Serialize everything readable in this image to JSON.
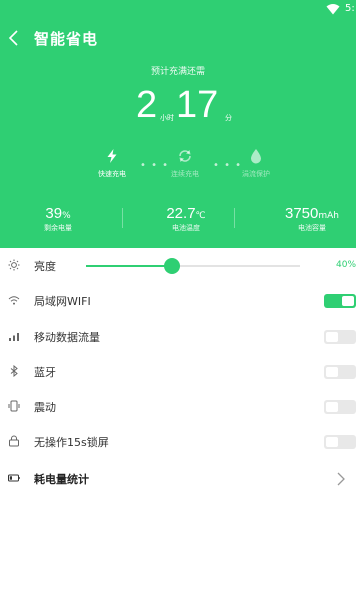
{
  "colors": {
    "accent": "#2fcf73",
    "header_bg": "#2fcf73",
    "text": "#333333"
  },
  "status_bar": {
    "time": "5:",
    "wifi_icon": "wifi-icon"
  },
  "header": {
    "back_icon": "back-arrow-icon",
    "title": "智能省电",
    "subtitle": "预计充满还需",
    "time": {
      "hours": "2",
      "hours_unit": "小时",
      "minutes": "17",
      "minutes_unit": "分"
    }
  },
  "charge_stages": [
    {
      "label": "快速充电",
      "icon": "lightning-icon",
      "active": true
    },
    {
      "label": "连续充电",
      "icon": "cycle-icon",
      "active": false
    },
    {
      "label": "涓流保护",
      "icon": "drop-icon",
      "active": false
    }
  ],
  "stats": [
    {
      "value": "39",
      "unit": "%",
      "label": "剩余电量"
    },
    {
      "value": "22.7",
      "unit": "℃",
      "label": "电池温度"
    },
    {
      "value": "3750",
      "unit": "mAh",
      "label": "电池容量"
    }
  ],
  "settings": {
    "brightness": {
      "label": "亮度",
      "icon": "brightness-icon",
      "level": 0.4,
      "value_text": "40%"
    },
    "wifi": {
      "label": "局域网WIFI",
      "icon": "wifi-signal-icon",
      "on": true
    },
    "mobile_data": {
      "label": "移动数据流量",
      "icon": "signal-bars-icon",
      "on": false
    },
    "bluetooth": {
      "label": "蓝牙",
      "icon": "bluetooth-icon",
      "on": false
    },
    "vibrate": {
      "label": "震动",
      "icon": "vibrate-icon",
      "on": false
    },
    "auto_lock": {
      "label": "无操作15s锁屏",
      "icon": "lock-icon",
      "on": false
    },
    "power_stats": {
      "label": "耗电量统计",
      "icon": "battery-icon",
      "chevron_icon": "chevron-right-icon"
    }
  }
}
